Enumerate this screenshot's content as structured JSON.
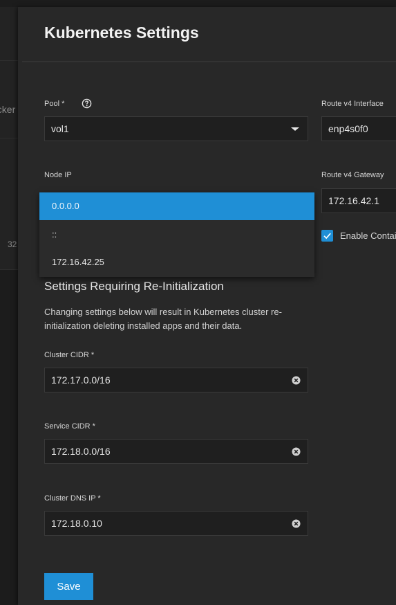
{
  "background": {
    "partial_text_1": "ocker",
    "partial_text_2": "32"
  },
  "panel": {
    "title": "Kubernetes Settings"
  },
  "pool": {
    "label": "Pool *",
    "value": "vol1",
    "help_icon": "question-circle-icon"
  },
  "route_v4_interface": {
    "label": "Route v4 Interface",
    "value": "enp4s0f0"
  },
  "node_ip": {
    "label": "Node IP",
    "options": [
      "0.0.0.0",
      "::",
      "172.16.42.25"
    ],
    "selected": "0.0.0.0"
  },
  "route_v4_gateway": {
    "label": "Route v4 Gateway",
    "value": "172.16.42.1"
  },
  "enable_container": {
    "label": "Enable Contai",
    "checked": true
  },
  "reinit_section": {
    "heading": "Settings Requiring Re-Initialization",
    "description": "Changing settings below will result in Kubernetes cluster re-initialization deleting installed apps and their data."
  },
  "cluster_cidr": {
    "label": "Cluster CIDR *",
    "value": "172.17.0.0/16"
  },
  "service_cidr": {
    "label": "Service CIDR *",
    "value": "172.18.0.0/16"
  },
  "cluster_dns_ip": {
    "label": "Cluster DNS IP *",
    "value": "172.18.0.10"
  },
  "actions": {
    "save_label": "Save"
  },
  "colors": {
    "accent": "#1f8fd6",
    "panel_bg": "#282828",
    "input_bg": "#1f1f1f"
  }
}
